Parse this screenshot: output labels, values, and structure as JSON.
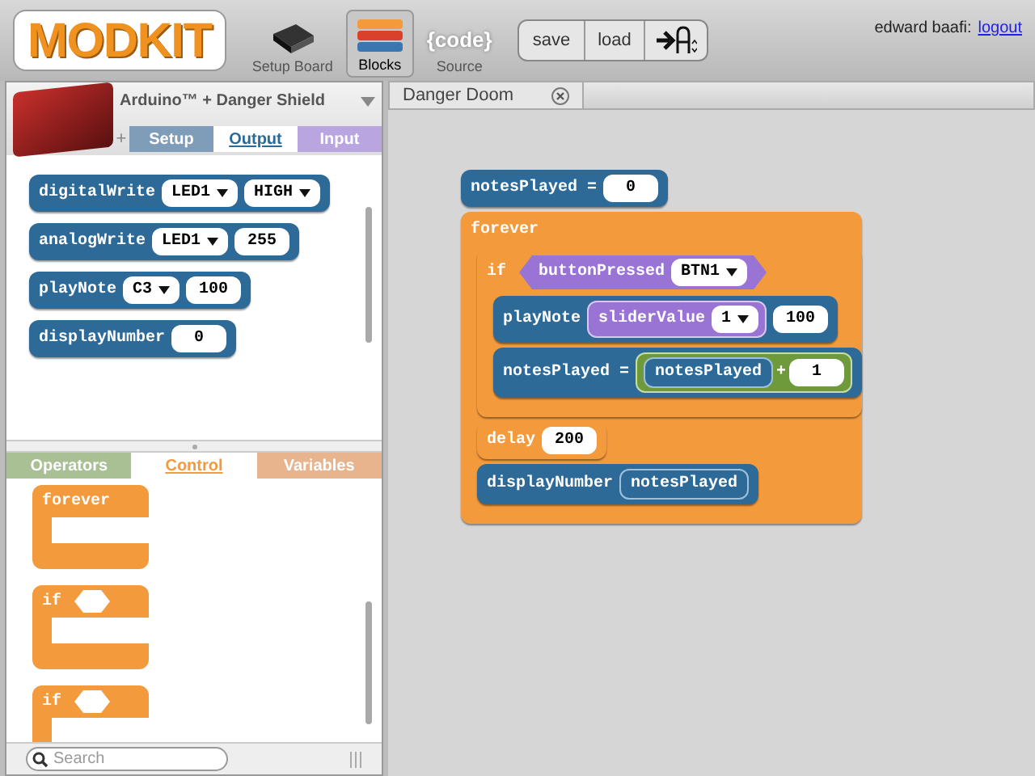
{
  "header": {
    "logo": "MODKIT",
    "modes": [
      {
        "kind": "board",
        "label": "Setup Board",
        "selected": false
      },
      {
        "kind": "blocks",
        "label": "Blocks",
        "selected": true
      },
      {
        "kind": "code",
        "label": "Source",
        "selected": false,
        "glyph": "{code}"
      }
    ],
    "actions": [
      "save",
      "load"
    ],
    "user": "edward baafi:",
    "logout": "logout"
  },
  "board_select": {
    "label": "Arduino™ + Danger Shield"
  },
  "add_tab": "+",
  "top_tabs": [
    {
      "label": "Setup",
      "selected": false,
      "color": "#7f9cb8"
    },
    {
      "label": "Output",
      "selected": true,
      "color": "#2a6a9a"
    },
    {
      "label": "Input",
      "selected": false,
      "color": "#b9a5e0"
    }
  ],
  "output_blocks": [
    {
      "kind": "command",
      "label": "digitalWrite",
      "args": [
        {
          "kind": "dropdown",
          "text": "LED1"
        },
        {
          "kind": "dropdown",
          "text": "HIGH"
        }
      ]
    },
    {
      "kind": "command",
      "label": "analogWrite",
      "args": [
        {
          "kind": "dropdown",
          "text": "LED1"
        },
        {
          "kind": "number",
          "text": "255"
        }
      ]
    },
    {
      "kind": "command",
      "label": "playNote",
      "args": [
        {
          "kind": "dropdown",
          "text": "C3"
        },
        {
          "kind": "number",
          "text": "100"
        }
      ]
    },
    {
      "kind": "command",
      "label": "displayNumber",
      "args": [
        {
          "kind": "number",
          "text": "0"
        }
      ]
    }
  ],
  "bottom_tabs": [
    {
      "label": "Operators",
      "selected": false,
      "color": "#a9bf94"
    },
    {
      "label": "Control",
      "selected": true,
      "color": "#f39a3c"
    },
    {
      "label": "Variables",
      "selected": false,
      "color": "#e8b48e"
    }
  ],
  "control_blocks": [
    {
      "kind": "forever",
      "label": "forever"
    },
    {
      "kind": "if",
      "label": "if"
    },
    {
      "kind": "if",
      "label": "if"
    }
  ],
  "search": {
    "placeholder": "Search"
  },
  "doc_tab": {
    "title": "Danger Doom"
  },
  "program": [
    {
      "kind": "command",
      "label": "notesPlayed =",
      "args": [
        {
          "kind": "number",
          "text": "0"
        }
      ]
    },
    {
      "kind": "forever",
      "label": "forever",
      "children": [
        {
          "kind": "if",
          "label": "if",
          "condition": {
            "kind": "sensor",
            "label": "buttonPressed",
            "args": [
              {
                "kind": "dropdown",
                "text": "BTN1"
              }
            ]
          },
          "children": [
            {
              "kind": "command",
              "label": "playNote",
              "args": [
                {
                  "kind": "reporter",
                  "label": "sliderValue",
                  "args": [
                    {
                      "kind": "dropdown",
                      "text": "1"
                    }
                  ]
                },
                {
                  "kind": "number",
                  "text": "100"
                }
              ]
            },
            {
              "kind": "command",
              "label": "notesPlayed =",
              "args": [
                {
                  "kind": "operator",
                  "op": "+",
                  "args": [
                    {
                      "kind": "variable",
                      "text": "notesPlayed"
                    },
                    {
                      "kind": "number",
                      "text": "1"
                    }
                  ]
                }
              ]
            }
          ]
        },
        {
          "kind": "control",
          "label": "delay",
          "args": [
            {
              "kind": "number",
              "text": "200"
            }
          ]
        },
        {
          "kind": "command",
          "label": "displayNumber",
          "args": [
            {
              "kind": "variable",
              "text": "notesPlayed"
            }
          ]
        }
      ]
    }
  ]
}
